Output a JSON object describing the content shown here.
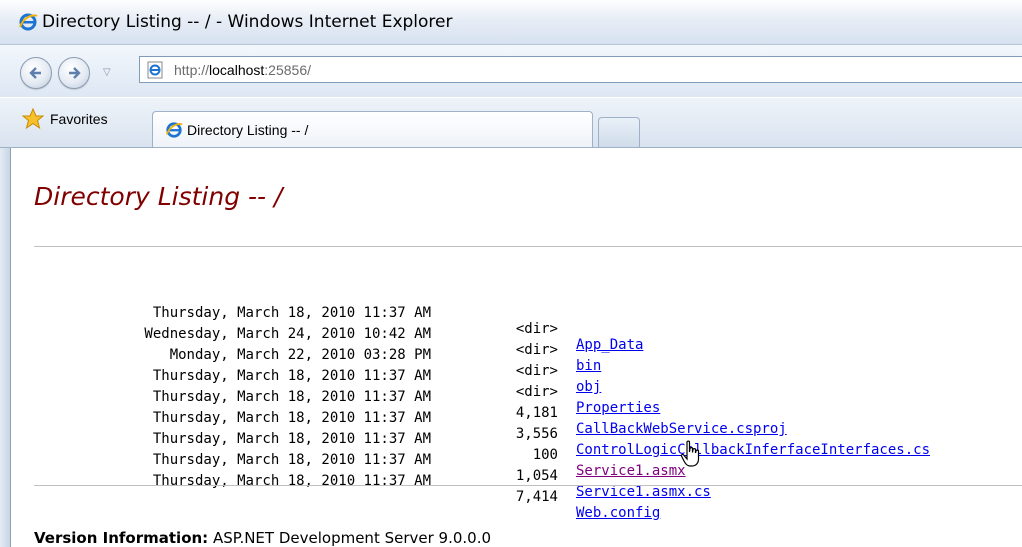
{
  "window": {
    "title": "Directory Listing -- / - Windows Internet Explorer"
  },
  "navigation": {
    "address_prefix": "http://",
    "address_host": "localhost",
    "address_suffix": ":25856/"
  },
  "toolbar": {
    "favorites_label": "Favorites"
  },
  "tabs": [
    {
      "label": "Directory Listing -- /"
    }
  ],
  "page": {
    "heading": "Directory Listing -- /",
    "entries": [
      {
        "date": "Thursday, March 18, 2010 11:37 AM",
        "size": "<dir>",
        "name": "App_Data"
      },
      {
        "date": "Wednesday, March 24, 2010 10:42 AM",
        "size": "<dir>",
        "name": "bin"
      },
      {
        "date": "Monday, March 22, 2010 03:28 PM",
        "size": "<dir>",
        "name": "obj"
      },
      {
        "date": "Thursday, March 18, 2010 11:37 AM",
        "size": "<dir>",
        "name": "Properties"
      },
      {
        "date": "Thursday, March 18, 2010 11:37 AM",
        "size": "4,181",
        "name": "CallBackWebService.csproj"
      },
      {
        "date": "Thursday, March 18, 2010 11:37 AM",
        "size": "3,556",
        "name": "ControlLogicCallbackInferfaceInterfaces.cs"
      },
      {
        "date": "Thursday, March 18, 2010 11:37 AM",
        "size": "100",
        "name": "Service1.asmx"
      },
      {
        "date": "Thursday, March 18, 2010 11:37 AM",
        "size": "1,054",
        "name": "Service1.asmx.cs"
      },
      {
        "date": "Thursday, March 18, 2010 11:37 AM",
        "size": "7,414",
        "name": "Web.config"
      }
    ],
    "version_label": "Version Information:",
    "version_text": "ASP.NET Development Server 9.0.0.0"
  },
  "icons": {
    "browser": "ie-icon",
    "back": "back-arrow-icon",
    "forward": "forward-arrow-icon",
    "favorites": "star-icon",
    "pointer": "hand-cursor-icon"
  },
  "colors": {
    "heading": "#800000",
    "link": "#0000ee",
    "visited_link": "#800080"
  }
}
